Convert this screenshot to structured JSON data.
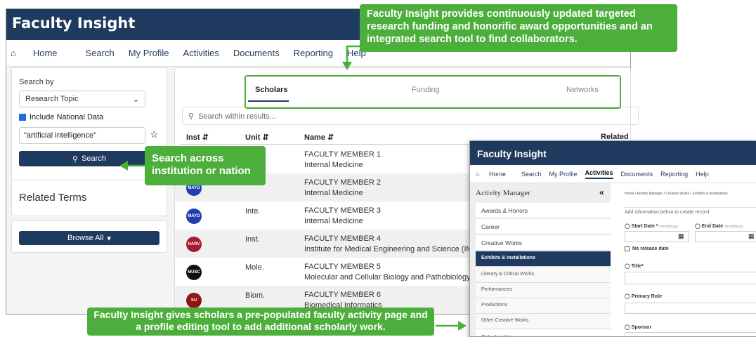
{
  "main": {
    "title": "Faculty Insight",
    "nav": [
      "Home",
      "Search",
      "My Profile",
      "Activities",
      "Documents",
      "Reporting",
      "Help"
    ],
    "search_by_label": "Search by",
    "search_by_value": "Research Topic",
    "include_national": "Include National Data",
    "query": "\"artificial intelligence\"",
    "search_btn": "Search",
    "related_terms": "Related Terms",
    "browse_all": "Browse All",
    "tabs": [
      "Scholars",
      "Funding",
      "Networks"
    ],
    "search_within": "Search within results...",
    "columns": [
      "Inst",
      "Unit",
      "Name",
      "Related"
    ],
    "rows": [
      {
        "logo": "",
        "inst": "",
        "unit": "",
        "name": "FACULTY MEMBER 1",
        "dept": "Internal Medicine",
        "color": "#1f3fb0"
      },
      {
        "logo": "MAYO",
        "inst": "",
        "unit": "",
        "name": "FACULTY MEMBER 2",
        "dept": "Internal Medicine",
        "color": "#1f3fb0"
      },
      {
        "logo": "MAYO",
        "inst": "",
        "unit": "Inte.",
        "name": "FACULTY MEMBER 3",
        "dept": "Internal Medicine",
        "color": "#1f3fb0"
      },
      {
        "logo": "HARV",
        "inst": "",
        "unit": "Inst.",
        "name": "FACULTY MEMBER 4",
        "dept": "Institute for Medical Engineering and Science (IMES)",
        "color": "#a51c30"
      },
      {
        "logo": "MUSC",
        "inst": "",
        "unit": "Mole.",
        "name": "FACULTY MEMBER 5",
        "dept": "Molecular and Cellular Biology and Pathobiology",
        "color": "#111111"
      },
      {
        "logo": "SU",
        "inst": "",
        "unit": "Biom.",
        "name": "FACULTY MEMBER 6",
        "dept": "Biomedical Informatics",
        "color": "#8c1515"
      }
    ]
  },
  "callouts": {
    "top": "Faculty Insight provides continuously updated targeted research funding and honorific award opportunities and an integrated search tool to find collaborators.",
    "mid": "Search across institution or nation",
    "bottom": "Faculty Insight gives scholars a pre-populated faculty activity page and a profile editing tool to add additional scholarly work."
  },
  "win2": {
    "title": "Faculty Insight",
    "nav": [
      "Home",
      "Search",
      "My Profile",
      "Activities",
      "Documents",
      "Reporting",
      "Help"
    ],
    "sidebar_title": "Activity Manager",
    "items": [
      "Awards & Honors",
      "Career",
      "Creative Works"
    ],
    "sub_items": [
      "Exhibits & Installations",
      "Literary & Critical Works",
      "Performances",
      "Productions",
      "Other Creative Works"
    ],
    "scholarship": "Scholarship",
    "breadcrumb": "Home / Activity Manager / Creative Works / Exhibits & Installations",
    "instruction": "Add information below to create record",
    "start_date": "Start Date *",
    "end_date": "End Date",
    "date_ph": "mm/dd/yyyy",
    "no_release": "No release date",
    "title_label": "Title*",
    "primary_role": "Primary Role",
    "sponsor": "Sponsor"
  }
}
